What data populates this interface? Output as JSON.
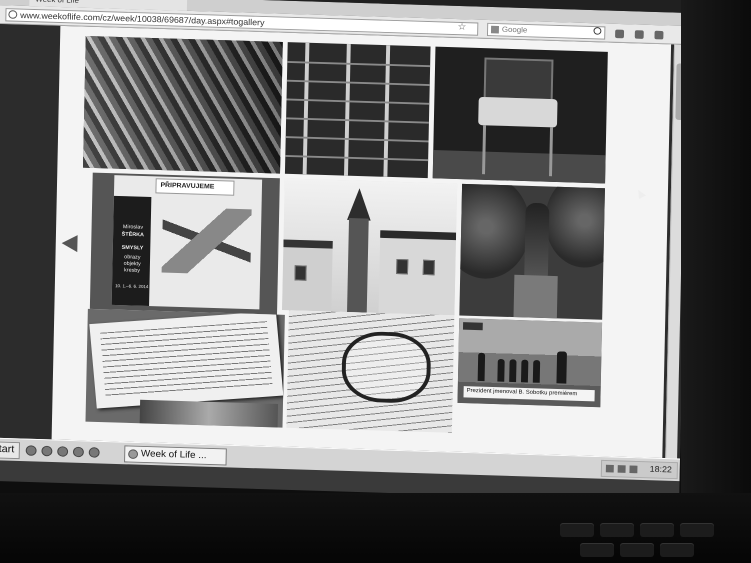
{
  "browser": {
    "tab_title": "Week of Life",
    "url": "www.weekoflife.com/cz/week/10038/69687/day.aspx#togallery",
    "search_placeholder": "Google"
  },
  "gallery": {
    "poster": {
      "heading": "PŘIPRAVUJEME",
      "artist_first": "Miroslav",
      "artist_last": "ŠTĚRKA",
      "title": "SMYSLY",
      "subtitle_1": "obrazy",
      "subtitle_2": "objekty",
      "subtitle_3": "kresby",
      "dates": "10. 1.–6. 6. 2014"
    },
    "tv_caption": "Prezident jmenoval B. Sobotku premiérem"
  },
  "taskbar": {
    "start_label": "start",
    "window_label": "Week of Life ...",
    "clock": "18:22"
  },
  "icons": {
    "prev": "triangle-left-icon",
    "search": "magnifier-icon",
    "bookmark": "star-icon"
  },
  "colors": {
    "page_bg": "#f4f4f4",
    "chrome": "#d4d4d4"
  }
}
